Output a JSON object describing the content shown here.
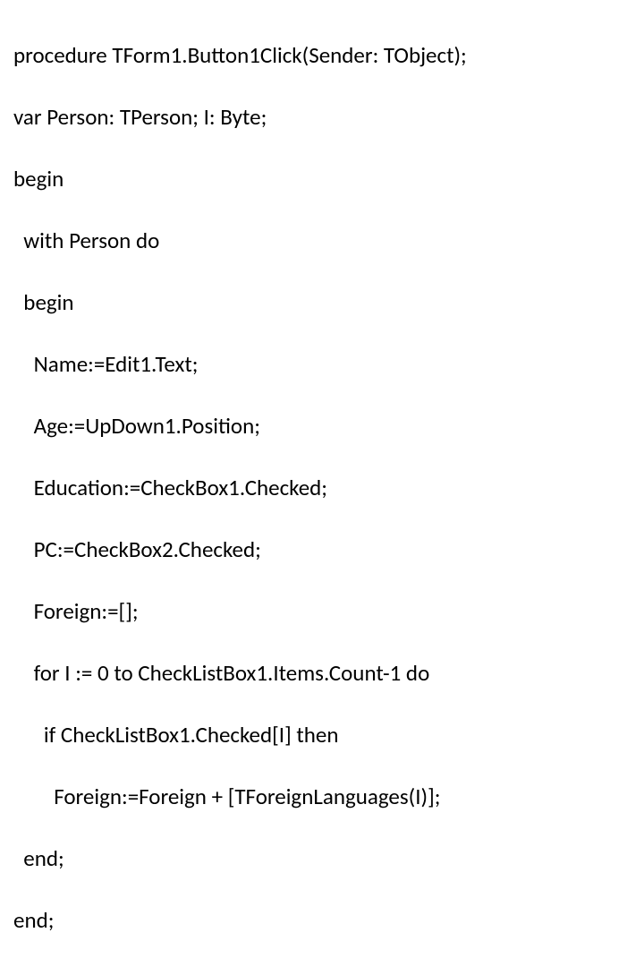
{
  "code": {
    "lines": [
      "procedure TForm1.Button1Click(Sender: TObject);",
      "var Person: TPerson; I: Byte;",
      "begin",
      "  with Person do",
      "  begin",
      "    Name:=Edit1.Text;",
      "    Age:=UpDown1.Position;",
      "    Education:=CheckBox1.Checked;",
      "    PC:=CheckBox2.Checked;",
      "    Foreign:=[];",
      "    for I := 0 to CheckListBox1.Items.Count-1 do",
      "      if CheckListBox1.Checked[I] then",
      "        Foreign:=Foreign + [TForeignLanguages(I)];",
      "  end;",
      "end;"
    ]
  }
}
